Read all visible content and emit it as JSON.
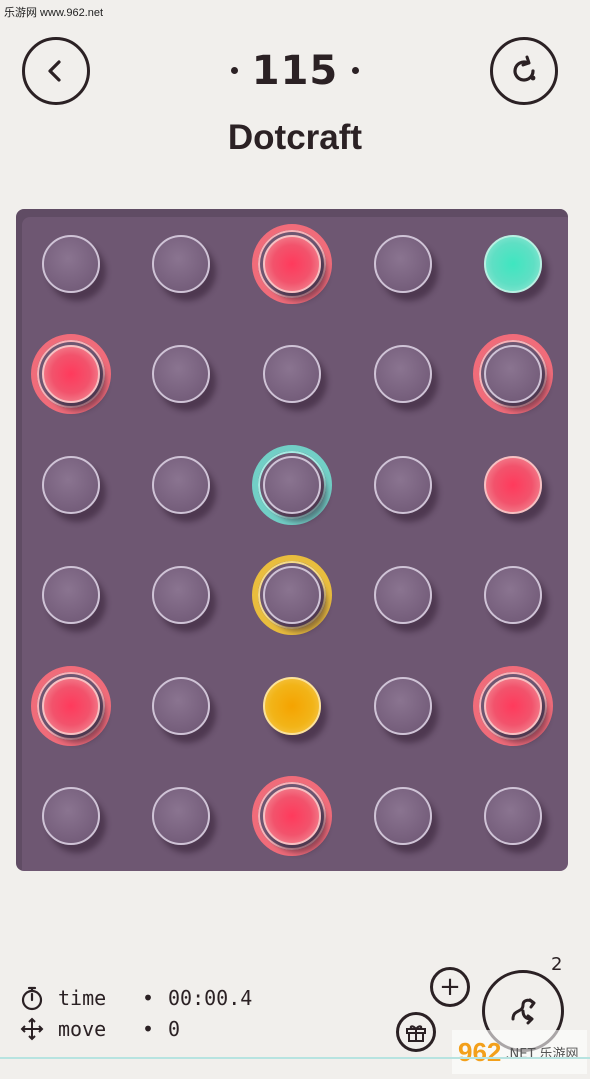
{
  "watermark": {
    "top_text": "乐游网 www.962.net",
    "bottom_logo": "962",
    "bottom_sub": ".NET 乐游网"
  },
  "header": {
    "level": "115",
    "title": "Dotcraft"
  },
  "colors": {
    "background": "#f1efec",
    "board": "#6e5772",
    "red": "#f2536c",
    "teal": "#5fdfc4",
    "yellow": "#f2b418"
  },
  "board": {
    "rows": 6,
    "cols": 5,
    "cells": [
      [
        "empty",
        "empty",
        "red-ring",
        "empty",
        "teal"
      ],
      [
        "red-ring",
        "empty",
        "empty",
        "empty",
        "empty-red-ring"
      ],
      [
        "empty",
        "empty",
        "empty-teal-ring",
        "empty",
        "red"
      ],
      [
        "empty",
        "empty",
        "empty-yellow-ring",
        "empty",
        "empty"
      ],
      [
        "red-ring",
        "empty",
        "yellow",
        "empty",
        "red-ring"
      ],
      [
        "empty",
        "empty",
        "red-ring",
        "empty",
        "empty"
      ]
    ]
  },
  "stats": {
    "time_label": "time",
    "time_value": "00:00.4",
    "move_label": "move",
    "move_value": "0",
    "separator": "•"
  },
  "hints": {
    "count": "2",
    "plus_label": "+"
  },
  "icons": {
    "back": "back-chevron-icon",
    "reset": "reset-icon",
    "stopwatch": "stopwatch-icon",
    "move": "move-arrows-icon",
    "hint": "hint-swap-icon",
    "gift": "gift-icon"
  }
}
